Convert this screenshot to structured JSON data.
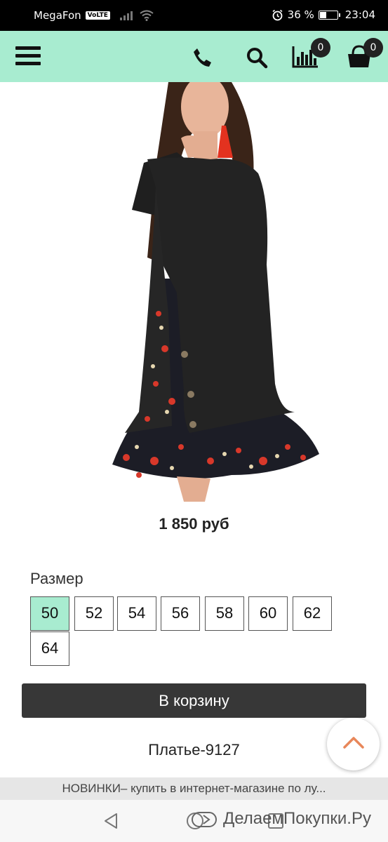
{
  "status_bar": {
    "carrier": "MegaFon",
    "network_badge": "VoLTE",
    "battery_percent": "36 %",
    "battery_level": 0.36,
    "time": "23:04",
    "icons": [
      "signal-icon",
      "wifi-icon",
      "alarm-icon",
      "battery-icon"
    ]
  },
  "header": {
    "background_color": "#a8ecd0",
    "icons": [
      "menu-icon",
      "phone-icon",
      "search-icon",
      "compare-chart-icon",
      "cart-icon"
    ],
    "compare_count": "0",
    "cart_count": "0"
  },
  "product": {
    "image_alt": "black dress with floral ruffle",
    "price": "1 850 руб",
    "size_label": "Размер",
    "sizes": [
      "50",
      "52",
      "54",
      "56",
      "58",
      "60",
      "62",
      "64"
    ],
    "selected_size": "50",
    "add_to_cart": "В корзину",
    "sku": "Платье-9127"
  },
  "browser": {
    "page_title": "НОВИНКИ– купить в интернет-магазине по лу..."
  },
  "watermark": "ДелаемПокупки.Ру",
  "colors": {
    "accent": "#a8ecd0",
    "button": "#373737",
    "scroll_arrow": "#e8875a"
  }
}
